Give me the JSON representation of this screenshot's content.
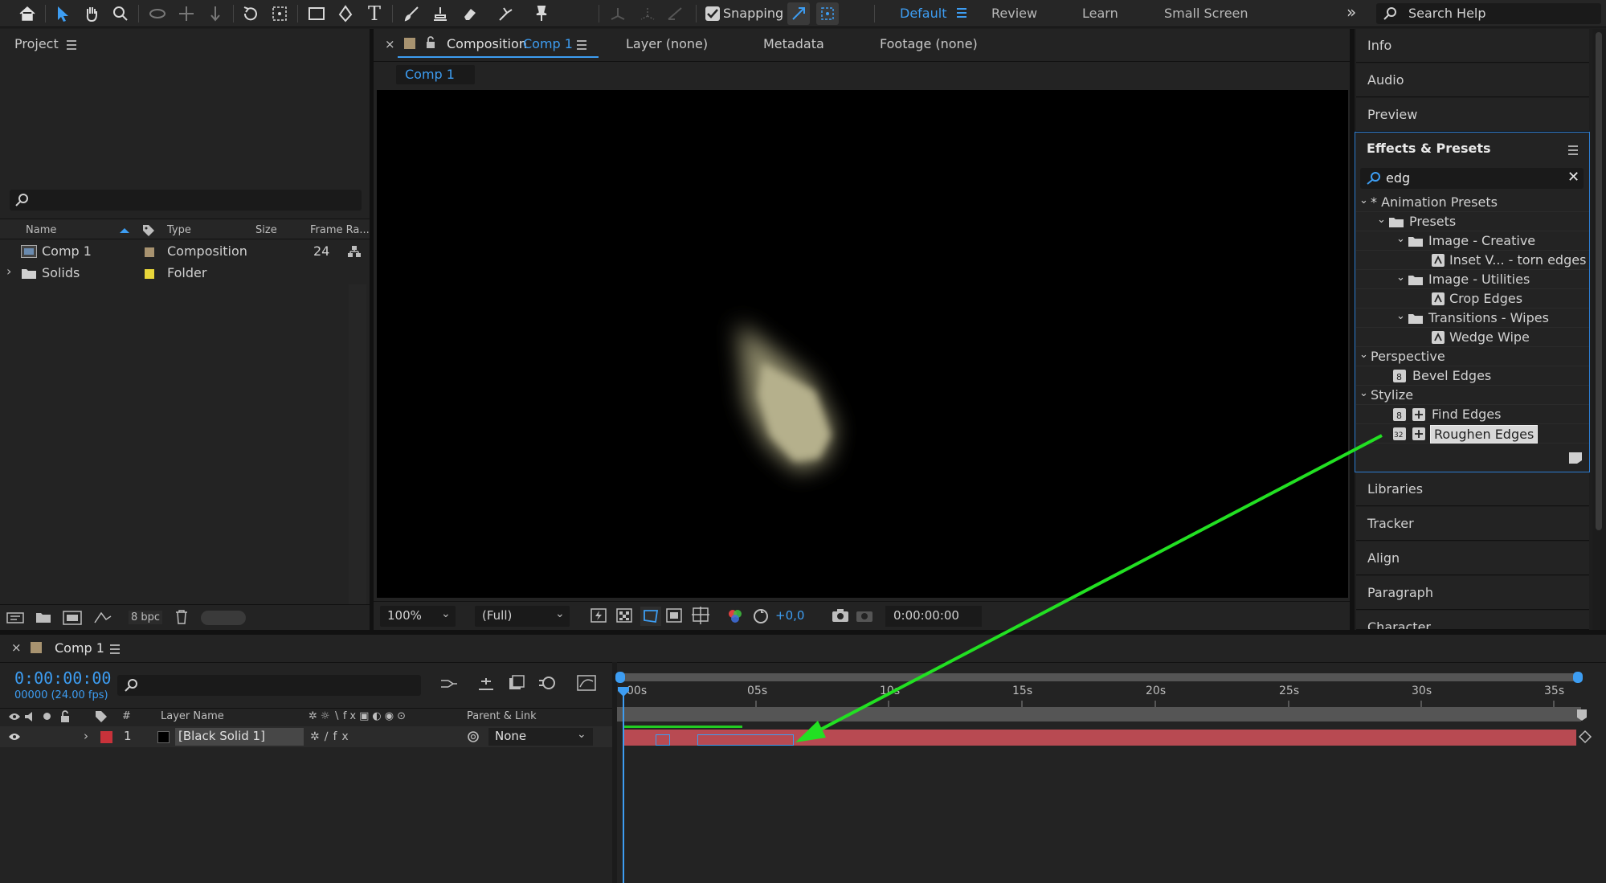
{
  "toolbar": {
    "snapping_label": "Snapping",
    "workspaces": [
      "Default",
      "Review",
      "Learn",
      "Small Screen"
    ],
    "search_placeholder": "Search Help",
    "active_color": "#3d9df2"
  },
  "project": {
    "title": "Project",
    "columns": [
      "Name",
      "Type",
      "Size",
      "Frame Ra..."
    ],
    "rows": [
      {
        "name": "Comp 1",
        "type": "Composition",
        "frame_rate": "24",
        "label_color": "#a89370"
      },
      {
        "name": "Solids",
        "type": "Folder",
        "frame_rate": "",
        "label_color": "#e8d63a"
      }
    ],
    "bpc": "8 bpc"
  },
  "viewer": {
    "tab_prefix": "Composition",
    "tab_comp": "Comp 1",
    "other_tabs": [
      "Layer (none)",
      "Metadata",
      "Footage (none)"
    ],
    "subtab": "Comp 1",
    "zoom": "100%",
    "resolution": "(Full)",
    "exposure": "+0,0",
    "timecode": "0:00:00:00"
  },
  "right_panels": {
    "top_tabs": [
      "Info",
      "Audio",
      "Preview"
    ],
    "effects_title": "Effects & Presets",
    "search_value": "edg",
    "tree": [
      {
        "label": "* Animation Presets",
        "type": "group"
      },
      {
        "label": "Presets",
        "type": "folder"
      },
      {
        "label": "Image - Creative",
        "type": "folder"
      },
      {
        "label": "Inset V... - torn edges",
        "type": "preset"
      },
      {
        "label": "Image - Utilities",
        "type": "folder"
      },
      {
        "label": "Crop Edges",
        "type": "preset"
      },
      {
        "label": "Transitions - Wipes",
        "type": "folder"
      },
      {
        "label": "Wedge Wipe",
        "type": "preset"
      },
      {
        "label": "Perspective",
        "type": "group"
      },
      {
        "label": "Bevel Edges",
        "type": "effect"
      },
      {
        "label": "Stylize",
        "type": "group"
      },
      {
        "label": "Find Edges",
        "type": "effect"
      },
      {
        "label": "Roughen Edges",
        "type": "effect",
        "selected": true
      }
    ],
    "bottom_tabs": [
      "Libraries",
      "Tracker",
      "Align",
      "Paragraph",
      "Character"
    ]
  },
  "timeline": {
    "comp_name": "Comp 1",
    "timecode": "0:00:00:00",
    "frame_info": "00000 (24.00 fps)",
    "col_layer_name": "Layer Name",
    "col_parent": "Parent & Link",
    "col_hash": "#",
    "ruler": [
      "00s",
      "05s",
      "10s",
      "15s",
      "20s",
      "25s",
      "30s",
      "35s"
    ],
    "layer": {
      "index": "1",
      "name": "[Black Solid 1]",
      "parent": "None",
      "label_color": "#c8323a",
      "bar_color": "#b84a52"
    }
  },
  "annotation_color": "#22e022"
}
